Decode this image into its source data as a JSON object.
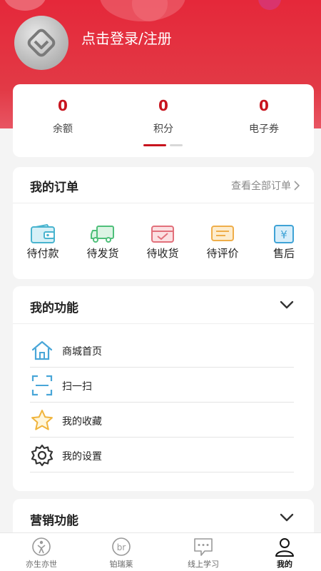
{
  "header": {
    "login_text": "点击登录/注册"
  },
  "assets": [
    {
      "value": "0",
      "label": "余额"
    },
    {
      "value": "0",
      "label": "积分"
    },
    {
      "value": "0",
      "label": "电子券"
    }
  ],
  "orders": {
    "title": "我的订单",
    "see_all": "查看全部订单",
    "items": [
      {
        "label": "待付款",
        "icon": "wallet-icon"
      },
      {
        "label": "待发货",
        "icon": "truck-icon"
      },
      {
        "label": "待收货",
        "icon": "package-icon"
      },
      {
        "label": "待评价",
        "icon": "comment-icon"
      },
      {
        "label": "售后",
        "icon": "yuan-receipt-icon"
      }
    ]
  },
  "functions": {
    "title": "我的功能",
    "items": [
      {
        "label": "商城首页",
        "icon": "home-icon"
      },
      {
        "label": "扫一扫",
        "icon": "scan-icon"
      },
      {
        "label": "我的收藏",
        "icon": "star-icon"
      },
      {
        "label": "我的设置",
        "icon": "gear-icon"
      }
    ]
  },
  "marketing": {
    "title": "营销功能"
  },
  "tabbar": {
    "items": [
      {
        "label": "亦生亦世",
        "icon": "yishengyishi-icon"
      },
      {
        "label": "铂瑞莱",
        "icon": "br-icon"
      },
      {
        "label": "线上学习",
        "icon": "chat-icon"
      },
      {
        "label": "我的",
        "icon": "user-icon"
      }
    ],
    "active": "我的"
  },
  "colors": {
    "brand_red": "#e5283a",
    "accent_red": "#c8141e"
  }
}
